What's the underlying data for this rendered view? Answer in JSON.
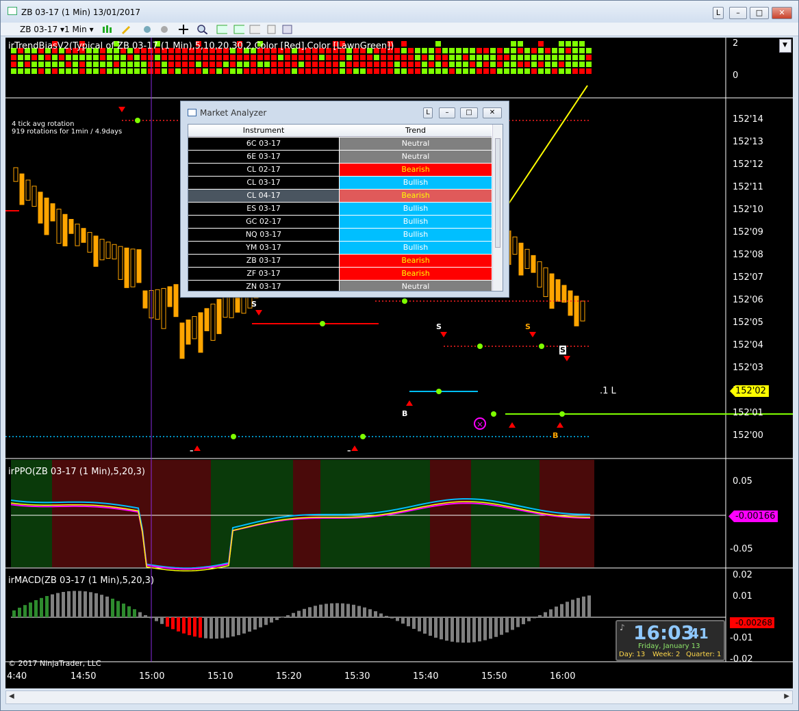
{
  "window": {
    "title": "ZB 03-17 (1 Min)  13/01/2017",
    "btn_l": "L",
    "btn_min": "–",
    "btn_max": "□",
    "btn_close": "✕"
  },
  "toolbar": {
    "instrument": "ZB 03-17",
    "interval": "1 Min"
  },
  "panels": {
    "trendbias": "irTrendBiasV2(Typical of ZB 03-17 (1 Min),5,10,20,30,2,Color [Red],Color [LawnGreen])",
    "ppo": "irPPO(ZB 03-17 (1 Min),5,20,3)",
    "macd": "irMACD(ZB 03-17 (1 Min),5,20,3)"
  },
  "notes": {
    "line1": "4 tick avg rotation",
    "line2": "919 rotations for 1min / 4.9days",
    "copyright": "© 2017 NinjaTrader, LLC",
    "pos_label": ".1  L"
  },
  "axis": {
    "trendbias": [
      "2",
      "0"
    ],
    "price": [
      "152'14",
      "152'13",
      "152'12",
      "152'11",
      "152'10",
      "152'09",
      "152'08",
      "152'07",
      "152'06",
      "152'05",
      "152'04",
      "152'03",
      "152'02",
      "152'01",
      "152'00"
    ],
    "ppo": [
      "0.05",
      "-0.05"
    ],
    "macd": [
      "0.02",
      "0.01",
      "-0.01",
      "-0.02"
    ],
    "time": [
      "4:40",
      "14:50",
      "15:00",
      "15:10",
      "15:20",
      "15:30",
      "15:40",
      "15:50",
      "16:00"
    ]
  },
  "tags": {
    "price": "152'02",
    "ppo": "-0.00166",
    "macd": "-0.00268"
  },
  "signals": {
    "s": "S",
    "b": "B",
    "dash": "–"
  },
  "clock": {
    "time": "16:03",
    "sec": "41",
    "date": "Friday, January 13",
    "day": "Day: 13",
    "week": "Week: 2",
    "quarter": "Quarter: 1"
  },
  "market_analyzer": {
    "title": "Market Analyzer",
    "btn_l": "L",
    "col_instrument": "Instrument",
    "col_trend": "Trend",
    "rows": [
      {
        "instrument": "6C 03-17",
        "trend": "Neutral",
        "bg": "#808080",
        "fg": "#ffffff",
        "ibg": "#000000"
      },
      {
        "instrument": "6E 03-17",
        "trend": "Neutral",
        "bg": "#808080",
        "fg": "#ffffff",
        "ibg": "#000000"
      },
      {
        "instrument": "CL 02-17",
        "trend": "Bearish",
        "bg": "#ff0000",
        "fg": "#ffff00",
        "ibg": "#000000"
      },
      {
        "instrument": "CL 03-17",
        "trend": "Bullish",
        "bg": "#00bfff",
        "fg": "#ffffff",
        "ibg": "#000000"
      },
      {
        "instrument": "CL 04-17",
        "trend": "Bearish",
        "bg": "#e05a5a",
        "fg": "#ffff00",
        "ibg": "#4a5560"
      },
      {
        "instrument": "ES 03-17",
        "trend": "Bullish",
        "bg": "#00bfff",
        "fg": "#ffffff",
        "ibg": "#000000"
      },
      {
        "instrument": "GC 02-17",
        "trend": "Bullish",
        "bg": "#00bfff",
        "fg": "#ffffff",
        "ibg": "#000000"
      },
      {
        "instrument": "NQ 03-17",
        "trend": "Bullish",
        "bg": "#00bfff",
        "fg": "#ffffff",
        "ibg": "#000000"
      },
      {
        "instrument": "YM 03-17",
        "trend": "Bullish",
        "bg": "#00bfff",
        "fg": "#ffffff",
        "ibg": "#000000"
      },
      {
        "instrument": "ZB 03-17",
        "trend": "Bearish",
        "bg": "#ff0000",
        "fg": "#ffff00",
        "ibg": "#000000"
      },
      {
        "instrument": "ZF 03-17",
        "trend": "Bearish",
        "bg": "#ff0000",
        "fg": "#ffff00",
        "ibg": "#000000"
      },
      {
        "instrument": "ZN 03-17",
        "trend": "Neutral",
        "bg": "#808080",
        "fg": "#ffffff",
        "ibg": "#000000"
      }
    ]
  },
  "colors": {
    "bull": "#7fff00",
    "bear": "#ff0000",
    "candle": "#ffa500",
    "accent": "#ffff00"
  }
}
